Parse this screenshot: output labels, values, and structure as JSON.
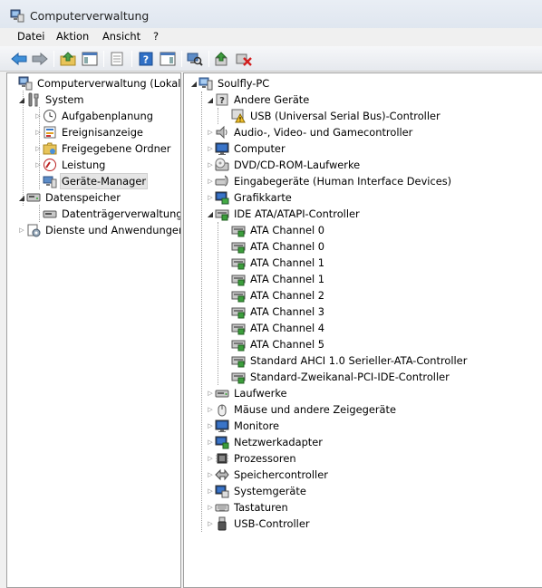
{
  "window": {
    "title": "Computerverwaltung"
  },
  "menu": [
    "Datei",
    "Aktion",
    "Ansicht",
    "?"
  ],
  "left_tree": [
    {
      "label": "Computerverwaltung (Lokal)",
      "icon": "computer-management-icon",
      "level": 0,
      "state": "none"
    },
    {
      "label": "System",
      "icon": "tools-icon",
      "level": 1,
      "state": "open"
    },
    {
      "label": "Aufgabenplanung",
      "icon": "clock-icon",
      "level": 2,
      "state": "closed"
    },
    {
      "label": "Ereignisanzeige",
      "icon": "event-viewer-icon",
      "level": 2,
      "state": "closed"
    },
    {
      "label": "Freigegebene Ordner",
      "icon": "shared-folder-icon",
      "level": 2,
      "state": "closed"
    },
    {
      "label": "Leistung",
      "icon": "performance-icon",
      "level": 2,
      "state": "closed"
    },
    {
      "label": "Geräte-Manager",
      "icon": "device-manager-icon",
      "level": 2,
      "state": "none",
      "selected": true
    },
    {
      "label": "Datenspeicher",
      "icon": "storage-icon",
      "level": 1,
      "state": "open"
    },
    {
      "label": "Datenträgerverwaltung",
      "icon": "disk-management-icon",
      "level": 2,
      "state": "none"
    },
    {
      "label": "Dienste und Anwendungen",
      "icon": "services-icon",
      "level": 1,
      "state": "closed"
    }
  ],
  "right_tree": [
    {
      "label": "Soulfly-PC",
      "icon": "pc-icon",
      "level": 0,
      "state": "open"
    },
    {
      "label": "Andere Geräte",
      "icon": "unknown-device-icon",
      "level": 1,
      "state": "open"
    },
    {
      "label": "USB (Universal Serial Bus)-Controller",
      "icon": "warning-device-icon",
      "level": 2,
      "state": "none"
    },
    {
      "label": "Audio-, Video- und Gamecontroller",
      "icon": "speaker-icon",
      "level": 1,
      "state": "closed"
    },
    {
      "label": "Computer",
      "icon": "monitor-icon",
      "level": 1,
      "state": "closed"
    },
    {
      "label": "DVD/CD-ROM-Laufwerke",
      "icon": "dvd-drive-icon",
      "level": 1,
      "state": "closed"
    },
    {
      "label": "Eingabegeräte (Human Interface Devices)",
      "icon": "hid-icon",
      "level": 1,
      "state": "closed"
    },
    {
      "label": "Grafikkarte",
      "icon": "display-adapter-icon",
      "level": 1,
      "state": "closed"
    },
    {
      "label": "IDE ATA/ATAPI-Controller",
      "icon": "ide-controller-icon",
      "level": 1,
      "state": "open"
    },
    {
      "label": "ATA Channel 0",
      "icon": "ide-controller-icon",
      "level": 2,
      "state": "none"
    },
    {
      "label": "ATA Channel 0",
      "icon": "ide-controller-icon",
      "level": 2,
      "state": "none"
    },
    {
      "label": "ATA Channel 1",
      "icon": "ide-controller-icon",
      "level": 2,
      "state": "none"
    },
    {
      "label": "ATA Channel 1",
      "icon": "ide-controller-icon",
      "level": 2,
      "state": "none"
    },
    {
      "label": "ATA Channel 2",
      "icon": "ide-controller-icon",
      "level": 2,
      "state": "none"
    },
    {
      "label": "ATA Channel 3",
      "icon": "ide-controller-icon",
      "level": 2,
      "state": "none"
    },
    {
      "label": "ATA Channel 4",
      "icon": "ide-controller-icon",
      "level": 2,
      "state": "none"
    },
    {
      "label": "ATA Channel 5",
      "icon": "ide-controller-icon",
      "level": 2,
      "state": "none"
    },
    {
      "label": "Standard AHCI 1.0 Serieller-ATA-Controller",
      "icon": "ide-controller-icon",
      "level": 2,
      "state": "none"
    },
    {
      "label": "Standard-Zweikanal-PCI-IDE-Controller",
      "icon": "ide-controller-icon",
      "level": 2,
      "state": "none"
    },
    {
      "label": "Laufwerke",
      "icon": "disk-drive-icon",
      "level": 1,
      "state": "closed"
    },
    {
      "label": "Mäuse und andere Zeigegeräte",
      "icon": "mouse-icon",
      "level": 1,
      "state": "closed"
    },
    {
      "label": "Monitore",
      "icon": "monitor-icon",
      "level": 1,
      "state": "closed"
    },
    {
      "label": "Netzwerkadapter",
      "icon": "network-adapter-icon",
      "level": 1,
      "state": "closed"
    },
    {
      "label": "Prozessoren",
      "icon": "processor-icon",
      "level": 1,
      "state": "closed"
    },
    {
      "label": "Speichercontroller",
      "icon": "storage-controller-icon",
      "level": 1,
      "state": "closed"
    },
    {
      "label": "Systemgeräte",
      "icon": "system-device-icon",
      "level": 1,
      "state": "closed"
    },
    {
      "label": "Tastaturen",
      "icon": "keyboard-icon",
      "level": 1,
      "state": "closed"
    },
    {
      "label": "USB-Controller",
      "icon": "usb-icon",
      "level": 1,
      "state": "closed"
    }
  ],
  "toolbar_buttons": [
    "back-arrow-icon",
    "forward-arrow-icon",
    "up-folder-icon",
    "show-hide-console-tree-icon",
    "export-list-icon",
    "help-icon",
    "show-hide-action-pane-icon",
    "scan-hardware-icon",
    "update-driver-icon",
    "uninstall-device-icon"
  ]
}
